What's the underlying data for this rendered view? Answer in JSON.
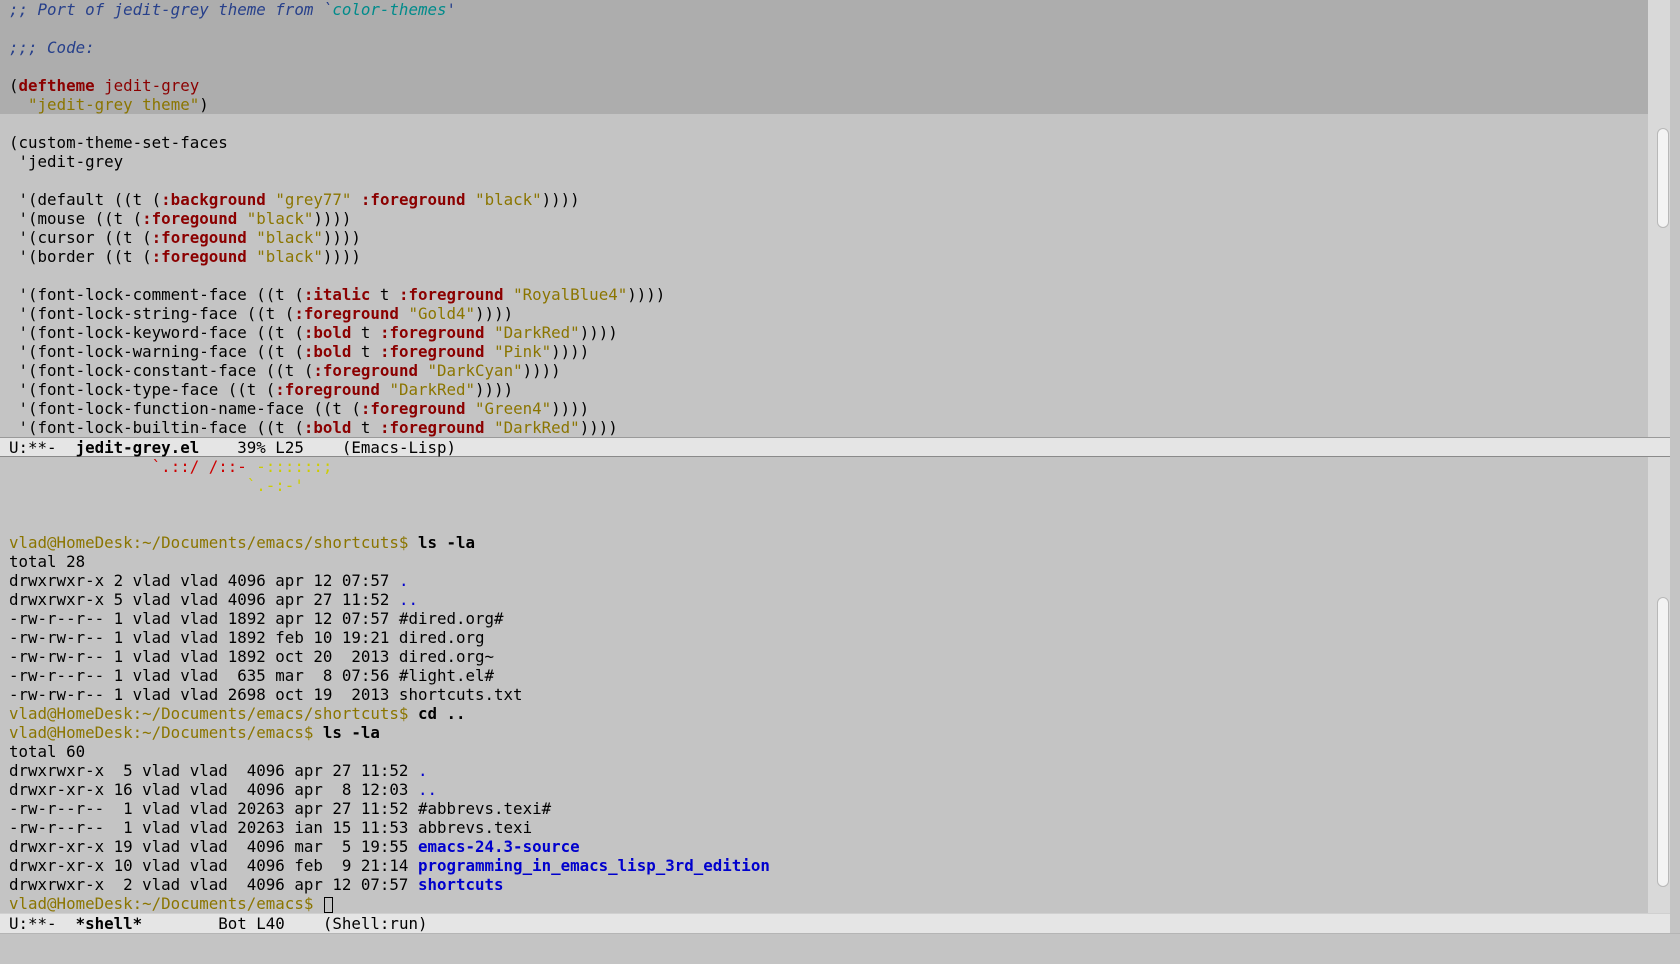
{
  "editor": {
    "top_lines": [
      [
        {
          "t": ";; Port of jedit-grey theme from `",
          "c": "c-comment"
        },
        {
          "t": "color-themes",
          "c": "c-doc"
        },
        {
          "t": "'",
          "c": "c-comment"
        }
      ],
      [],
      [
        {
          "t": ";;; Code:",
          "c": "c-comment"
        }
      ],
      [],
      [
        {
          "t": "("
        },
        {
          "t": "deftheme",
          "c": "c-kw"
        },
        {
          "t": " "
        },
        {
          "t": "jedit-grey",
          "c": "c-fn"
        }
      ],
      [
        {
          "t": "  "
        },
        {
          "t": "\"jedit-grey theme\"",
          "c": "c-str"
        },
        {
          "t": ")"
        }
      ],
      [],
      [
        {
          "t": "(custom-theme-set-faces"
        }
      ],
      [
        {
          "t": " 'jedit-grey"
        }
      ],
      [],
      [
        {
          "t": " '(default ((t ("
        },
        {
          "t": ":background",
          "c": "c-kw"
        },
        {
          "t": " "
        },
        {
          "t": "\"grey77\"",
          "c": "c-str"
        },
        {
          "t": " "
        },
        {
          "t": ":foreground",
          "c": "c-kw"
        },
        {
          "t": " "
        },
        {
          "t": "\"black\"",
          "c": "c-str"
        },
        {
          "t": "))))"
        }
      ],
      [
        {
          "t": " '(mouse ((t ("
        },
        {
          "t": ":foregound",
          "c": "c-kw"
        },
        {
          "t": " "
        },
        {
          "t": "\"black\"",
          "c": "c-str"
        },
        {
          "t": "))))"
        }
      ],
      [
        {
          "t": " '(cursor ((t ("
        },
        {
          "t": ":foregound",
          "c": "c-kw"
        },
        {
          "t": " "
        },
        {
          "t": "\"black\"",
          "c": "c-str"
        },
        {
          "t": "))))"
        }
      ],
      [
        {
          "t": " '(border ((t ("
        },
        {
          "t": ":foregound",
          "c": "c-kw"
        },
        {
          "t": " "
        },
        {
          "t": "\"black\"",
          "c": "c-str"
        },
        {
          "t": "))))"
        }
      ],
      [],
      [
        {
          "t": " '(font-lock-comment-face ((t ("
        },
        {
          "t": ":italic",
          "c": "c-kw"
        },
        {
          "t": " t "
        },
        {
          "t": ":foreground",
          "c": "c-kw"
        },
        {
          "t": " "
        },
        {
          "t": "\"RoyalBlue4\"",
          "c": "c-str"
        },
        {
          "t": "))))"
        }
      ],
      [
        {
          "t": " '(font-lock-string-face ((t ("
        },
        {
          "t": ":foreground",
          "c": "c-kw"
        },
        {
          "t": " "
        },
        {
          "t": "\"Gold4\"",
          "c": "c-str"
        },
        {
          "t": "))))"
        }
      ],
      [
        {
          "t": " '(font-lock-keyword-face ((t ("
        },
        {
          "t": ":bold",
          "c": "c-kw"
        },
        {
          "t": " t "
        },
        {
          "t": ":foreground",
          "c": "c-kw"
        },
        {
          "t": " "
        },
        {
          "t": "\"DarkRed\"",
          "c": "c-str"
        },
        {
          "t": "))))"
        }
      ],
      [
        {
          "t": " '(font-lock-warning-face ((t ("
        },
        {
          "t": ":bold",
          "c": "c-kw"
        },
        {
          "t": " t "
        },
        {
          "t": ":foreground",
          "c": "c-kw"
        },
        {
          "t": " "
        },
        {
          "t": "\"Pink\"",
          "c": "c-str"
        },
        {
          "t": "))))"
        }
      ],
      [
        {
          "t": " '(font-lock-constant-face ((t ("
        },
        {
          "t": ":foreground",
          "c": "c-kw"
        },
        {
          "t": " "
        },
        {
          "t": "\"DarkCyan\"",
          "c": "c-str"
        },
        {
          "t": "))))"
        }
      ],
      [
        {
          "t": " '(font-lock-type-face ((t ("
        },
        {
          "t": ":foreground",
          "c": "c-kw"
        },
        {
          "t": " "
        },
        {
          "t": "\"DarkRed\"",
          "c": "c-str"
        },
        {
          "t": "))))"
        }
      ],
      [
        {
          "t": " '(font-lock-function-name-face ((t ("
        },
        {
          "t": ":foreground",
          "c": "c-kw"
        },
        {
          "t": " "
        },
        {
          "t": "\"Green4\"",
          "c": "c-str"
        },
        {
          "t": "))))"
        }
      ],
      [
        {
          "t": " '(font-lock-builtin-face ((t ("
        },
        {
          "t": ":bold",
          "c": "c-kw"
        },
        {
          "t": " t "
        },
        {
          "t": ":foreground",
          "c": "c-kw"
        },
        {
          "t": " "
        },
        {
          "t": "\"DarkRed\"",
          "c": "c-str"
        },
        {
          "t": "))))"
        }
      ]
    ],
    "highlighted_lines": 6
  },
  "modeline_top": {
    "status": "U:**-  ",
    "buffer": "jedit-grey.el",
    "position": "    39% L25    ",
    "mode": "(Emacs-Lisp)"
  },
  "shell": {
    "lines": [
      [
        {
          "t": "               "
        },
        {
          "t": "`.::/ /::-",
          "c": "c-red"
        },
        {
          "t": " "
        },
        {
          "t": "-::::::;",
          "c": "c-yel"
        }
      ],
      [
        {
          "t": "                         "
        },
        {
          "t": "`.-:-'",
          "c": "c-yel"
        }
      ],
      [],
      [],
      [
        {
          "t": "vlad@HomeDesk:~/Documents/emacs/shortcuts$ ",
          "c": "c-prompt"
        },
        {
          "t": "ls -la",
          "c": "c-cmd"
        }
      ],
      [
        {
          "t": "total 28"
        }
      ],
      [
        {
          "t": "drwxrwxr-x 2 vlad vlad 4096 apr 12 07:57 "
        },
        {
          "t": ".",
          "c": "c-dir"
        }
      ],
      [
        {
          "t": "drwxrwxr-x 5 vlad vlad 4096 apr 27 11:52 "
        },
        {
          "t": "..",
          "c": "c-dir"
        }
      ],
      [
        {
          "t": "-rw-r--r-- 1 vlad vlad 1892 apr 12 07:57 #dired.org#"
        }
      ],
      [
        {
          "t": "-rw-rw-r-- 1 vlad vlad 1892 feb 10 19:21 dired.org"
        }
      ],
      [
        {
          "t": "-rw-rw-r-- 1 vlad vlad 1892 oct 20  2013 dired.org~"
        }
      ],
      [
        {
          "t": "-rw-r--r-- 1 vlad vlad  635 mar  8 07:56 #light.el#"
        }
      ],
      [
        {
          "t": "-rw-rw-r-- 1 vlad vlad 2698 oct 19  2013 shortcuts.txt"
        }
      ],
      [
        {
          "t": "vlad@HomeDesk:~/Documents/emacs/shortcuts$ ",
          "c": "c-prompt"
        },
        {
          "t": "cd ..",
          "c": "c-cmd"
        }
      ],
      [
        {
          "t": "vlad@HomeDesk:~/Documents/emacs$ ",
          "c": "c-prompt"
        },
        {
          "t": "ls -la",
          "c": "c-cmd"
        }
      ],
      [
        {
          "t": "total 60"
        }
      ],
      [
        {
          "t": "drwxrwxr-x  5 vlad vlad  4096 apr 27 11:52 "
        },
        {
          "t": ".",
          "c": "c-dir"
        }
      ],
      [
        {
          "t": "drwxr-xr-x 16 vlad vlad  4096 apr  8 12:03 "
        },
        {
          "t": "..",
          "c": "c-dir"
        }
      ],
      [
        {
          "t": "-rw-r--r--  1 vlad vlad 20263 apr 27 11:52 #abbrevs.texi#"
        }
      ],
      [
        {
          "t": "-rw-r--r--  1 vlad vlad 20263 ian 15 11:53 abbrevs.texi"
        }
      ],
      [
        {
          "t": "drwxr-xr-x 19 vlad vlad  4096 mar  5 19:55 "
        },
        {
          "t": "emacs-24.3-source",
          "c": "c-dirb"
        }
      ],
      [
        {
          "t": "drwxr-xr-x 10 vlad vlad  4096 feb  9 21:14 "
        },
        {
          "t": "programming_in_emacs_lisp_3rd_edition",
          "c": "c-dirb"
        }
      ],
      [
        {
          "t": "drwxrwxr-x  2 vlad vlad  4096 apr 12 07:57 "
        },
        {
          "t": "shortcuts",
          "c": "c-dirb"
        }
      ],
      [
        {
          "t": "vlad@HomeDesk:~/Documents/emacs$ ",
          "c": "c-prompt"
        }
      ]
    ]
  },
  "modeline_bottom": {
    "status": "U:**-  ",
    "buffer": "*shell*",
    "position": "        Bot L40    ",
    "mode": "(Shell:run)"
  },
  "echo_area": ""
}
